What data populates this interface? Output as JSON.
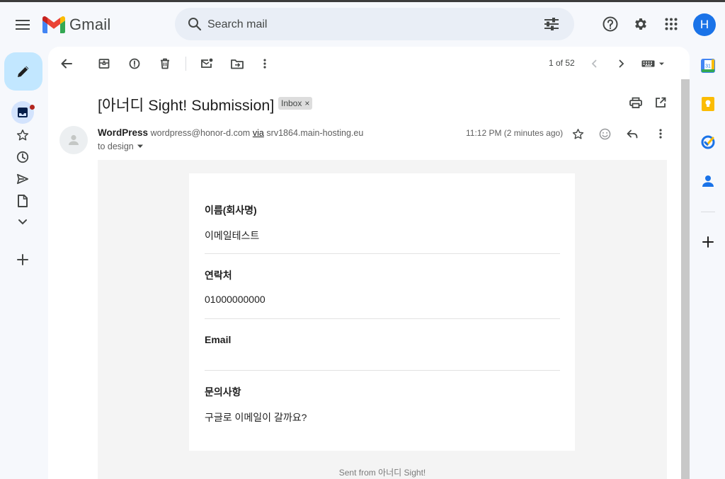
{
  "app": {
    "name": "Gmail"
  },
  "search": {
    "placeholder": "Search mail"
  },
  "user": {
    "avatar_letter": "H"
  },
  "toolbar": {
    "pager": "1 of 52"
  },
  "email": {
    "subject": "[아너디 Sight! Submission]",
    "label": "Inbox",
    "label_remove": "×",
    "sender_name": "WordPress",
    "sender_email": "wordpress@honor-d.com",
    "via_label": "via",
    "relay_host": "srv1864.main-hosting.eu",
    "to": "to design",
    "time": "11:12 PM (2 minutes ago)",
    "fields": [
      {
        "label": "이름(회사명)",
        "value": "이메일테스트"
      },
      {
        "label": "연락처",
        "value": "01000000000"
      },
      {
        "label": "Email",
        "value": ""
      },
      {
        "label": "문의사항",
        "value": "구글로 이메일이 갈까요?"
      }
    ],
    "footer": "Sent from 아너디 Sight!"
  },
  "side_panel": {
    "calendar_day": "31"
  },
  "colors": {
    "accent": "#1a73e8",
    "compose_bg": "#c2e7ff",
    "background": "#f6f8fc",
    "search_bg": "#e9eef6",
    "notif_dot": "#b3261e"
  }
}
